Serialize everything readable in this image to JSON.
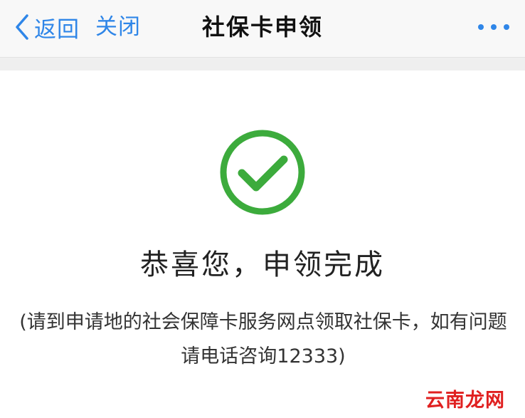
{
  "navbar": {
    "back_label": "返回",
    "close_label": "关闭",
    "title": "社保卡申领",
    "more_icon": "more-horizontal-icon",
    "accent_color": "#2f86e8"
  },
  "result": {
    "status_icon": "success-check-icon",
    "status_color": "#3cab3c",
    "heading": "恭喜您，申领完成",
    "note": "(请到申请地的社会保障卡服务网点领取社保卡，如有问题请电话咨询12333)"
  },
  "watermark": "云南龙网"
}
